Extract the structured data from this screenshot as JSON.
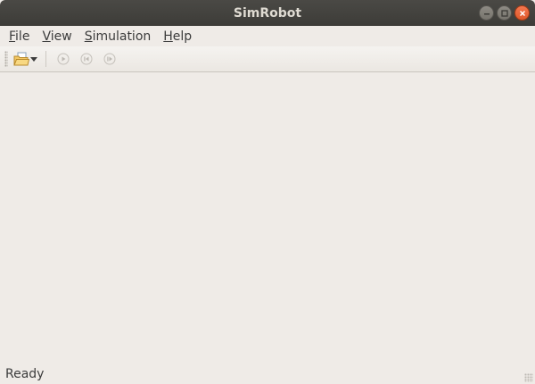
{
  "window": {
    "title": "SimRobot",
    "controls": {
      "minimize_icon": "minimize-icon",
      "maximize_icon": "maximize-icon",
      "close_icon": "close-icon"
    }
  },
  "menubar": {
    "items": [
      {
        "mnemonic": "F",
        "rest": "ile"
      },
      {
        "mnemonic": "V",
        "rest": "iew"
      },
      {
        "mnemonic": "S",
        "rest": "imulation"
      },
      {
        "mnemonic": "H",
        "rest": "elp"
      }
    ]
  },
  "toolbar": {
    "buttons": [
      {
        "icon": "open-folder-icon",
        "enabled": true,
        "has_dropdown": true
      },
      {
        "icon": "play-icon",
        "enabled": false
      },
      {
        "icon": "reset-icon",
        "enabled": false
      },
      {
        "icon": "step-icon",
        "enabled": false
      }
    ]
  },
  "status": {
    "text": "Ready"
  },
  "colors": {
    "titlebar": "#3d3c38",
    "close": "#e05a2b",
    "background": "#efebe7"
  }
}
